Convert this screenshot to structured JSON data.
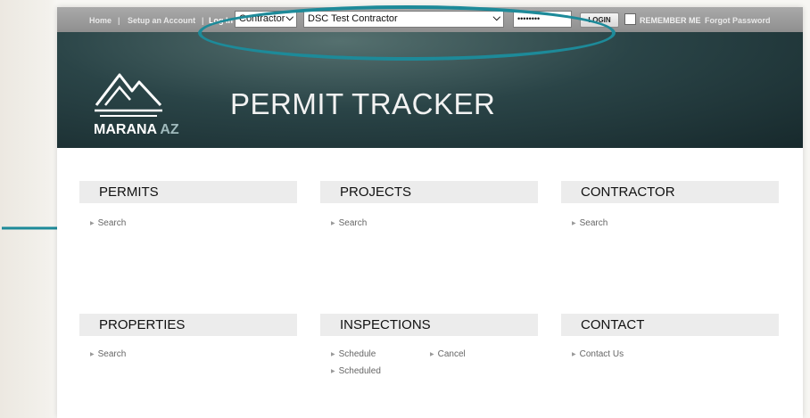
{
  "topbar": {
    "home": "Home",
    "separator": "|",
    "setup_account": "Setup an Account",
    "log_in": "Log In",
    "user_type": "Contractor",
    "contractor_name": "DSC Test Contractor",
    "password_mask": "••••••••",
    "login_button": "LOGIN",
    "remember_me": "REMEMBER ME",
    "forgot_password": "Forgot Password"
  },
  "banner": {
    "logo_name": "MARANA",
    "logo_suffix": "AZ",
    "title": "PERMIT TRACKER"
  },
  "sections": {
    "permits": {
      "title": "PERMITS",
      "items": [
        "Search"
      ]
    },
    "projects": {
      "title": "PROJECTS",
      "items": [
        "Search"
      ]
    },
    "contractor": {
      "title": "CONTRACTOR",
      "items": [
        "Search"
      ]
    },
    "properties": {
      "title": "PROPERTIES",
      "items": [
        "Search"
      ]
    },
    "inspections": {
      "title": "INSPECTIONS",
      "items": [
        "Schedule",
        "Cancel",
        "Scheduled"
      ]
    },
    "contact": {
      "title": "CONTACT",
      "items": [
        "Contact Us"
      ]
    }
  },
  "colors": {
    "annotation": "#1d8a99",
    "banner": "#2a4447",
    "section_header": "#ececec"
  }
}
